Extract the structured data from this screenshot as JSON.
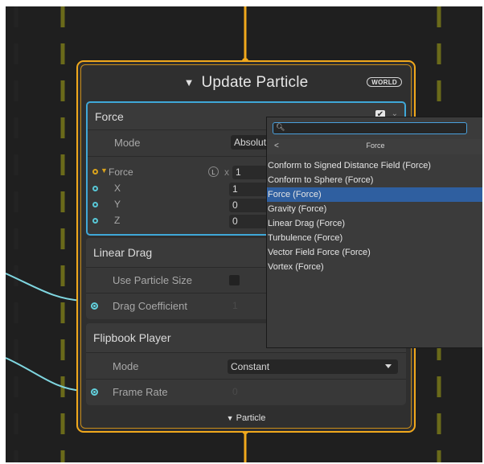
{
  "node": {
    "title": "Update Particle",
    "space_badge": "WORLD",
    "footer_label": "Particle",
    "force_block": {
      "header": "Force",
      "mode_label": "Mode",
      "mode_value": "Absolute",
      "force_label": "Force",
      "space_toggle": "L",
      "multiplier_prefix": "x",
      "multiplier_value": "1",
      "x_label": "X",
      "x_value": "1",
      "y_label": "Y",
      "y_value": "0",
      "z_label": "Z",
      "z_value": "0"
    },
    "linear_drag_block": {
      "header": "Linear Drag",
      "use_particle_size_label": "Use Particle Size",
      "drag_coefficient_label": "Drag Coefficient",
      "drag_coefficient_value": "1"
    },
    "flipbook_block": {
      "header": "Flipbook Player",
      "mode_label": "Mode",
      "mode_value": "Constant",
      "frame_rate_label": "Frame Rate",
      "frame_rate_value": "0"
    }
  },
  "popup": {
    "search_value": "",
    "header_title": "Force",
    "back_glyph": "<",
    "items": [
      "Conform to Signed Distance Field (Force)",
      "Conform to Sphere (Force)",
      "Force (Force)",
      "Gravity (Force)",
      "Linear Drag (Force)",
      "Turbulence (Force)",
      "Vector Field Force (Force)",
      "Vortex (Force)"
    ],
    "selected_index": 2
  },
  "colors": {
    "node_border": "#f0a81c",
    "selected_block_border": "#3fa8d8",
    "edge_cyan": "#7fd6e0",
    "selected_item": "#2f5fa0"
  }
}
